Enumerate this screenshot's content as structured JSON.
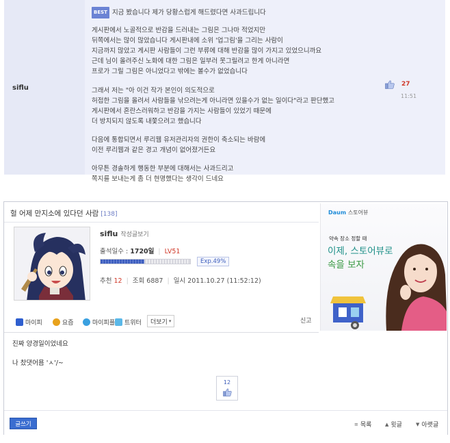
{
  "comment": {
    "badge": "BEST",
    "author": "siflu",
    "lines": [
      "지금 봤습니다 제가 당황스럽게 해드렸다면 사과드립니다",
      "",
      "게시판에서 노골적으로 반감을 드러내는 그림은 그나마 적었지만",
      "뒤쪽에서는 많이 많았습니다 게시판내에 소위 '업그림'을 그리는 사람이",
      "지금까지 많았고 게시판 사람들이 그런 부류에 대해 반감을 많이 가지고 있었으니까요",
      "근데 님이 올려주신 노화에 대한 그림은 일부러 못그릴려고 한게 아니라면",
      "프로가 그릴 그림은 아니었다고 밖에는 볼수가 없었습니다",
      "",
      "그래서 저는 \"아 이건 작가 본인이 의도적으로",
      "허접한 그림을 올려서 사람들을 낚으려는게 아니라면 있을수가 없는 일이다\"라고 판단했고",
      "게시판에서 혼란스러워하고 반감을 가지는 사람들이 있었기 때문에",
      "더 방치되지 않도록 내쫓으려고 했습니다",
      "",
      "다음에 통합되면서 루리웹 유저관리자의 권한이 축소되는 바람에",
      "이전 루리웹과 같은 경고 개념이 없어졌거든요",
      "",
      "아무튼 경솔하게 행동한 부분에 대해서는 사과드리고",
      "쪽지를 보내는게 좀 더 현명했다는 생각이 드네요"
    ],
    "votes": "27",
    "time": "11:51"
  },
  "post": {
    "title": "헐 어제 만지소에 있다던 사람",
    "title_count": "[138]",
    "author": "siflu",
    "author_link": "작성글보기",
    "attendance_label": "출석일수 :",
    "attendance_value": "1720일",
    "level": "LV51",
    "exp_label": "Exp.49%",
    "exp_fraction": 0.49,
    "recommend_label": "추천",
    "recommend_value": "12",
    "views_label": "조회",
    "views_value": "6887",
    "date_label": "일시",
    "date_value": "2011.10.27 (11:52:12)",
    "share": [
      "마이피",
      "요즘",
      "마이피플",
      "트위터"
    ],
    "more_label": "더보기",
    "report_label": "신고",
    "body": [
      "진짜 양경일이었네요",
      "나 찼댓어욤 'ㅅ'/~"
    ],
    "rec_count": "12",
    "write_label": "글쓰기",
    "nav": [
      "목록",
      "윗글",
      "아랫글"
    ]
  },
  "ad": {
    "brand": "Daum",
    "brand_sub": "스토어뷰",
    "subline": "약속 장소 정할 때",
    "copy": [
      "이제, 스토어뷰로",
      "속을 보자"
    ]
  },
  "colors": {
    "accent": "#3a6dd0",
    "badge": "#6b83d4",
    "count_red": "#d03a2a",
    "comment_bg": "#eef0fa"
  }
}
